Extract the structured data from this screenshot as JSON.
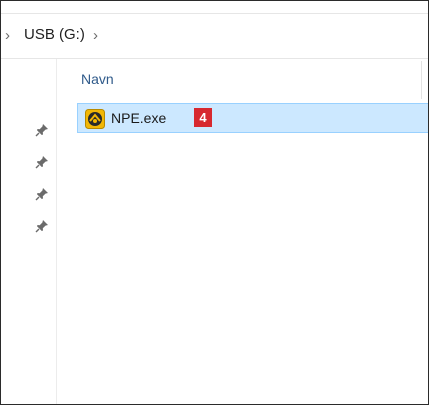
{
  "addressbar": {
    "path": "USB (G:)"
  },
  "file_list": {
    "column_header": "Navn",
    "items": [
      {
        "name": "NPE.exe",
        "badge": "4"
      }
    ]
  },
  "navpane": {
    "pinned_count": 4
  },
  "colors": {
    "selection_bg": "#cce8ff",
    "selection_border": "#99d1ff",
    "badge_bg": "#d7282f",
    "header_text": "#2f5a8a"
  }
}
